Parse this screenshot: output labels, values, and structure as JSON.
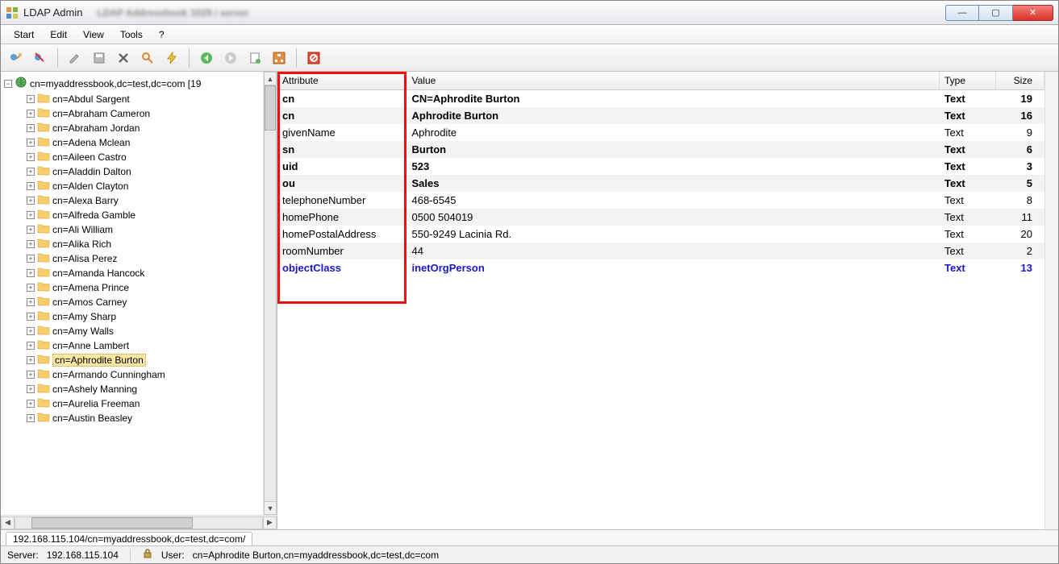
{
  "window": {
    "title": "LDAP Admin",
    "blurred_sub": "LDAP Addressbook 1029 / server"
  },
  "menu": {
    "start": "Start",
    "edit": "Edit",
    "view": "View",
    "tools": "Tools",
    "help": "?"
  },
  "tree": {
    "root_label": "cn=myaddressbook,dc=test,dc=com [19",
    "selected": "cn=Aphrodite Burton",
    "items": [
      "cn=Abdul Sargent",
      "cn=Abraham Cameron",
      "cn=Abraham Jordan",
      "cn=Adena Mclean",
      "cn=Aileen Castro",
      "cn=Aladdin Dalton",
      "cn=Alden Clayton",
      "cn=Alexa Barry",
      "cn=Alfreda Gamble",
      "cn=Ali William",
      "cn=Alika Rich",
      "cn=Alisa Perez",
      "cn=Amanda Hancock",
      "cn=Amena Prince",
      "cn=Amos Carney",
      "cn=Amy Sharp",
      "cn=Amy Walls",
      "cn=Anne Lambert",
      "cn=Aphrodite Burton",
      "cn=Armando Cunningham",
      "cn=Ashely Manning",
      "cn=Aurelia Freeman",
      "cn=Austin Beasley"
    ]
  },
  "attr_headers": {
    "attribute": "Attribute",
    "value": "Value",
    "type": "Type",
    "size": "Size"
  },
  "attributes": [
    {
      "attr": "cn",
      "value": "CN=Aphrodite Burton",
      "type": "Text",
      "size": "19",
      "bold": true
    },
    {
      "attr": "cn",
      "value": "Aphrodite Burton",
      "type": "Text",
      "size": "16",
      "bold": true,
      "striped": true
    },
    {
      "attr": "givenName",
      "value": "Aphrodite",
      "type": "Text",
      "size": "9"
    },
    {
      "attr": "sn",
      "value": "Burton",
      "type": "Text",
      "size": "6",
      "bold": true,
      "striped": true
    },
    {
      "attr": "uid",
      "value": "523",
      "type": "Text",
      "size": "3",
      "bold": true
    },
    {
      "attr": "ou",
      "value": "Sales",
      "type": "Text",
      "size": "5",
      "bold": true,
      "striped": true
    },
    {
      "attr": "telephoneNumber",
      "value": "468-6545",
      "type": "Text",
      "size": "8"
    },
    {
      "attr": "homePhone",
      "value": "0500 504019",
      "type": "Text",
      "size": "11",
      "striped": true
    },
    {
      "attr": "homePostalAddress",
      "value": "550-9249 Lacinia Rd.",
      "type": "Text",
      "size": "20"
    },
    {
      "attr": "roomNumber",
      "value": "44",
      "type": "Text",
      "size": "2",
      "striped": true
    },
    {
      "attr": "objectClass",
      "value": "inetOrgPerson",
      "type": "Text",
      "size": "13",
      "bold": true,
      "blue": true
    }
  ],
  "path_tab": "192.168.115.104/cn=myaddressbook,dc=test,dc=com/",
  "status": {
    "server_label": "Server:",
    "server_value": "192.168.115.104",
    "user_label": "User:",
    "user_value": "cn=Aphrodite Burton,cn=myaddressbook,dc=test,dc=com"
  }
}
